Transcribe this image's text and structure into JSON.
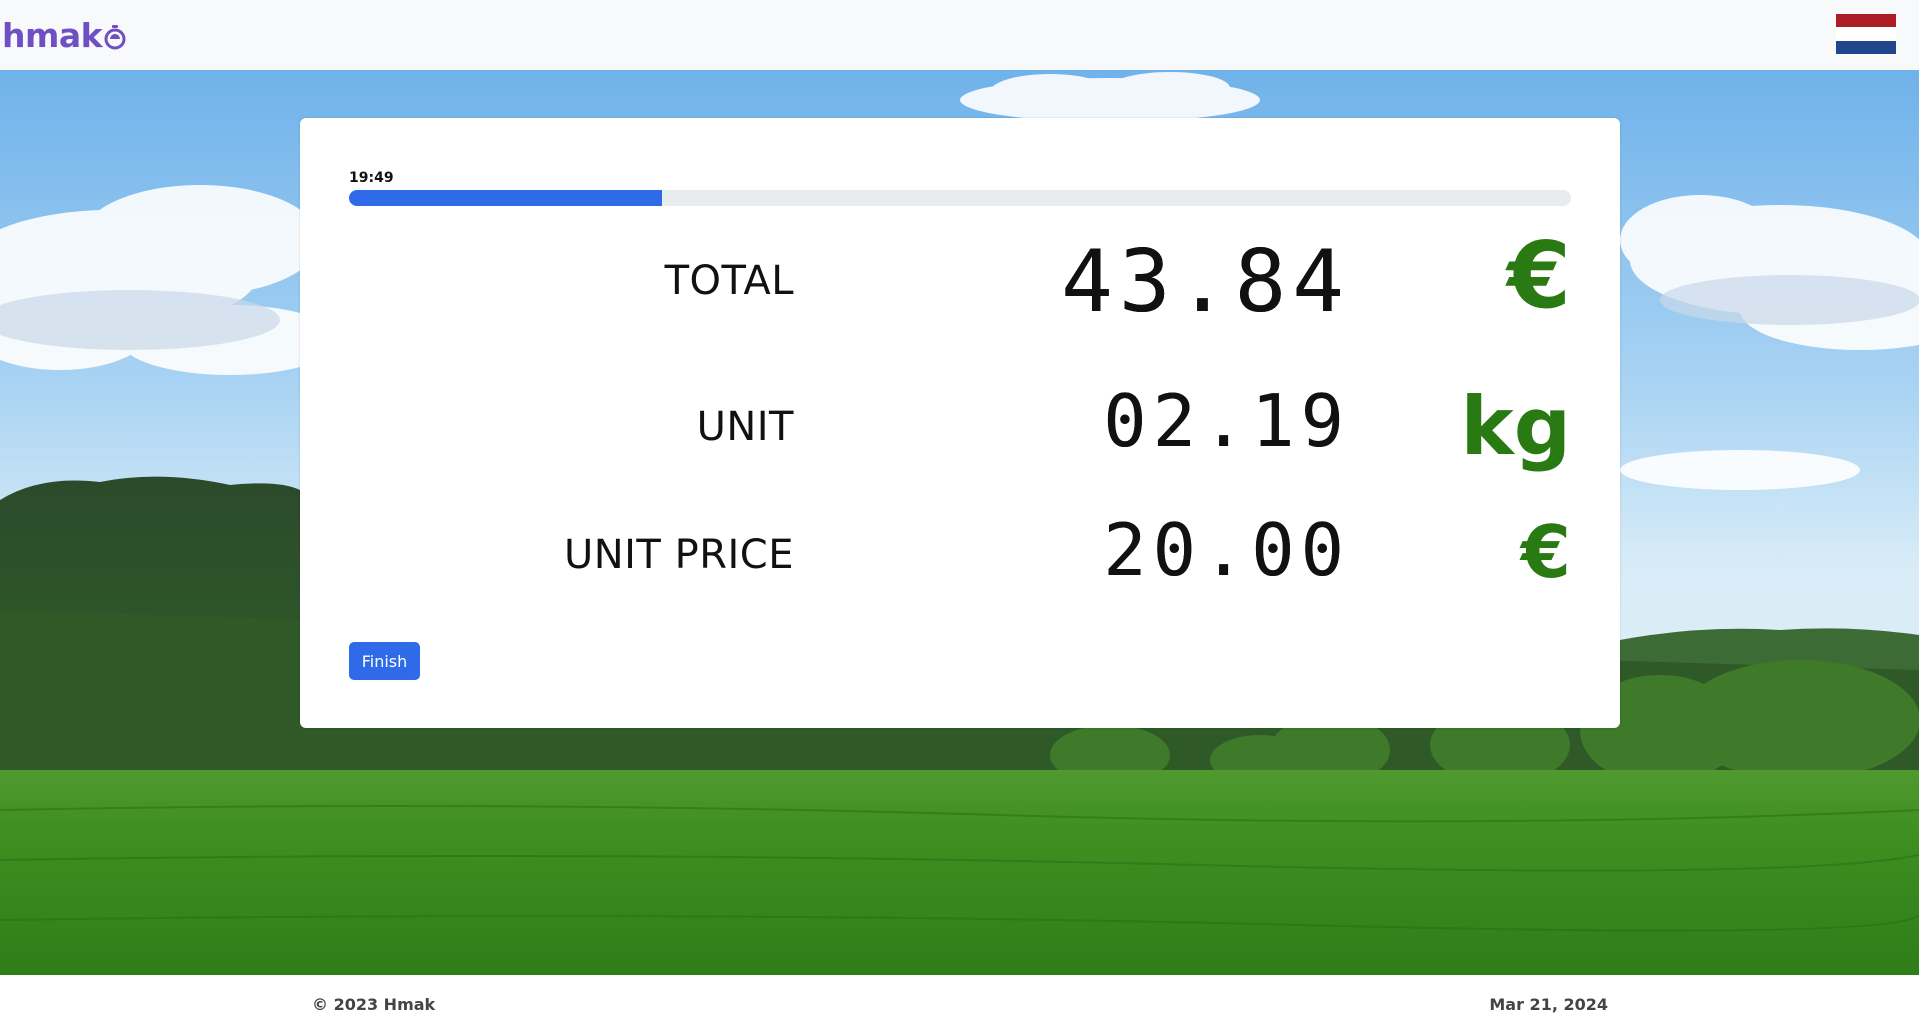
{
  "header": {
    "brand": "hmak",
    "language_flag": "netherlands-flag"
  },
  "card": {
    "timer": "19:49",
    "progress_percent": 25.6,
    "rows": [
      {
        "label": "TOTAL",
        "value": "43.84",
        "unit": "€"
      },
      {
        "label": "UNIT",
        "value": "02.19",
        "unit": "kg"
      },
      {
        "label": "UNIT PRICE",
        "value": "20.00",
        "unit": "€"
      }
    ],
    "finish_label": "Finish"
  },
  "footer": {
    "copyright": "© 2023 Hmak",
    "date": "Mar 21, 2024"
  },
  "colors": {
    "brand": "#6f4fc4",
    "primary": "#2f6be8",
    "unit_green": "#2a7a14",
    "flag_red": "#ae1c28",
    "flag_white": "#ffffff",
    "flag_blue": "#21468b"
  }
}
